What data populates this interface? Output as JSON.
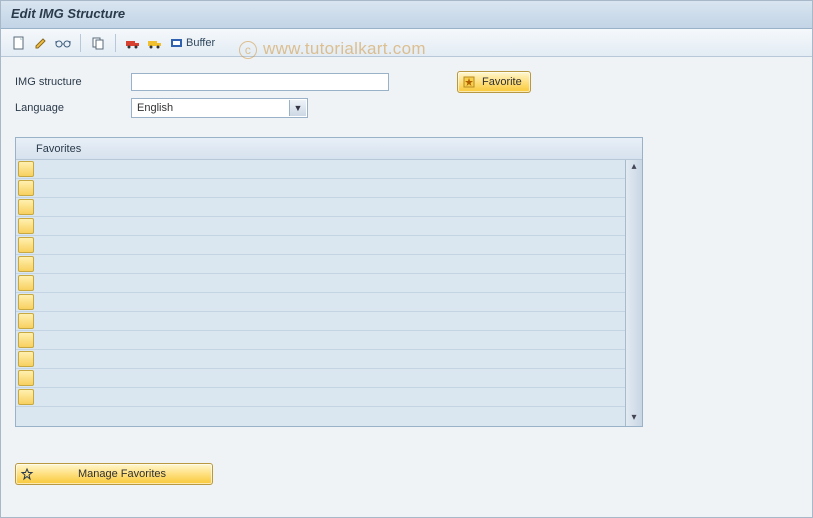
{
  "title": "Edit IMG Structure",
  "toolbar": {
    "buffer_label": "Buffer"
  },
  "form": {
    "structure_label": "IMG structure",
    "structure_value": "",
    "language_label": "Language",
    "language_value": "English"
  },
  "buttons": {
    "favorite": "Favorite",
    "manage_favorites": "Manage Favorites"
  },
  "favorites": {
    "header": "Favorites",
    "rows": [
      "",
      "",
      "",
      "",
      "",
      "",
      "",
      "",
      "",
      "",
      "",
      "",
      ""
    ]
  },
  "watermark": "www.tutorialkart.com"
}
